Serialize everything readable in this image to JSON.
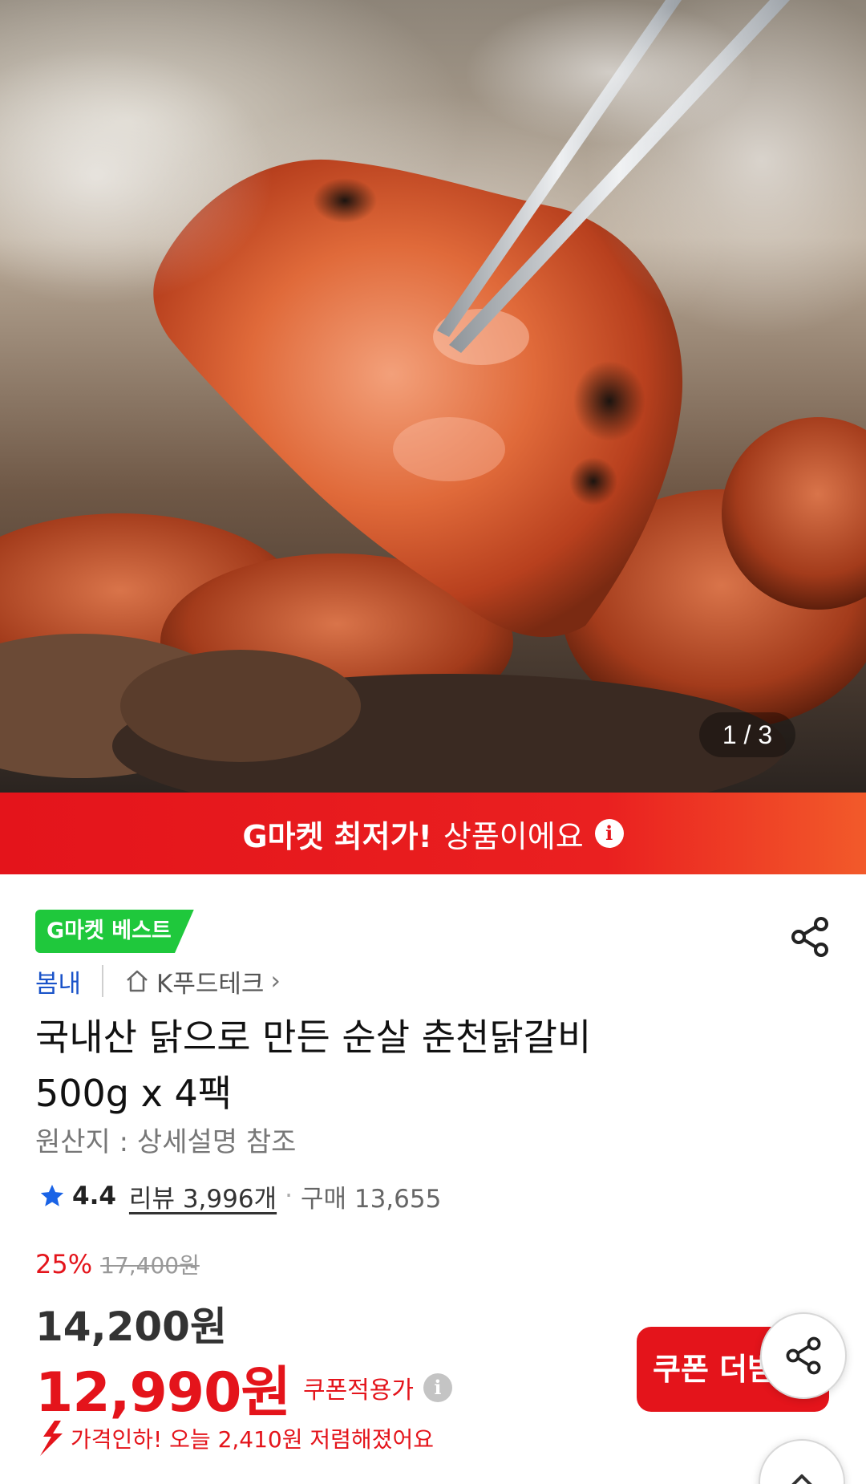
{
  "hero": {
    "image_description_icon": "grilled-chicken-photo",
    "counter": "1 / 3"
  },
  "banner": {
    "strong": "G마켓 최저가!",
    "text": "상품이에요",
    "info_icon": "i"
  },
  "product": {
    "badge": "G마켓 베스트",
    "brand": "봄내",
    "store": "K푸드테크",
    "store_chevron": "›",
    "title_line1": "국내산 닭으로 만든 순살 춘천닭갈비",
    "title_line2": "500g x 4팩",
    "origin": "원산지 : 상세설명 참조"
  },
  "rating": {
    "score": "4.4",
    "review": "리뷰 3,996개",
    "separator": "·",
    "purchases": "구매 13,655"
  },
  "price": {
    "discount": "25%",
    "original": "17,400원",
    "sale": "14,200원",
    "coupon_price": "12,990원",
    "coupon_label": "쿠폰적용가",
    "info_icon": "i",
    "drop_text": "가격인하! 오늘 2,410원 저렴해졌어요"
  },
  "buttons": {
    "coupon": "쿠폰 더받기"
  },
  "colors": {
    "accent_red": "#e4141b",
    "badge_green": "#1fc83c",
    "brand_blue": "#1a53c9"
  }
}
